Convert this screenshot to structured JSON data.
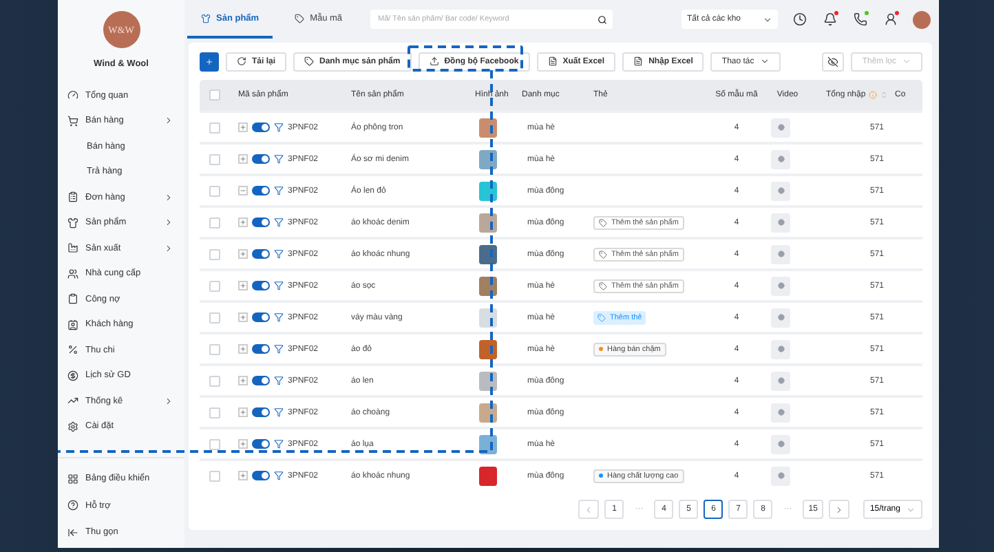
{
  "brand": {
    "logo": "W&W",
    "name": "Wind & Wool"
  },
  "sidebar": {
    "items": [
      {
        "label": "Tổng quan",
        "expandable": false
      },
      {
        "label": "Bán hàng",
        "expandable": true,
        "children": [
          {
            "label": "Bán hàng"
          },
          {
            "label": "Trả hàng"
          }
        ]
      },
      {
        "label": "Đơn hàng",
        "expandable": true
      },
      {
        "label": "Sản phẩm",
        "expandable": true
      },
      {
        "label": "Sản xuất",
        "expandable": true
      },
      {
        "label": "Nhà cung cấp",
        "expandable": false
      },
      {
        "label": "Công nợ",
        "expandable": false
      },
      {
        "label": "Khách hàng",
        "expandable": false
      },
      {
        "label": "Thu chi",
        "expandable": false
      },
      {
        "label": "Lịch sử GD",
        "expandable": false
      },
      {
        "label": "Thống kê",
        "expandable": true
      },
      {
        "label": "Cài đặt",
        "expandable": false
      }
    ],
    "bottom": [
      {
        "label": "Bảng điều khiển"
      },
      {
        "label": "Hỗ trợ"
      },
      {
        "label": "Thu gọn"
      }
    ]
  },
  "tabs": [
    {
      "label": "Sản phẩm",
      "selected": true
    },
    {
      "label": "Mẫu mã",
      "selected": false
    }
  ],
  "search": {
    "placeholder": "Mã/ Tên sản phẩm/ Bar code/ Keyword"
  },
  "warehouse_select": {
    "value": "Tất cả các kho"
  },
  "header_actions": [
    {
      "dot": false
    },
    {
      "dot": true,
      "color": "#f5222d"
    },
    {
      "dot": true,
      "color": "#52c41a"
    },
    {
      "dot": true,
      "color": "#f5222d"
    }
  ],
  "toolbar": {
    "buttons": [
      {
        "kind": "add"
      },
      {
        "kind": "reload",
        "label": "Tải lại"
      },
      {
        "kind": "tag",
        "label": "Danh mục sản phẩm"
      },
      {
        "kind": "upload",
        "label": "Đồng bộ Facebook"
      },
      {
        "kind": "file",
        "label": "Xuất Excel"
      },
      {
        "kind": "file",
        "label": "Nhập Excel"
      },
      {
        "kind": "dropdown",
        "label": "Thao tác"
      }
    ],
    "right": [
      {
        "kind": "eye"
      },
      {
        "kind": "dropdown",
        "label": "Thêm lọc",
        "disabled": true
      }
    ]
  },
  "table": {
    "select_all_checked": false,
    "columns": [
      "Mã sản phẩm",
      "Tên sản phẩm",
      "Hình ảnh",
      "Danh mục",
      "Thẻ",
      "Số mẫu mã",
      "Video",
      "Tổng nhập",
      "Co"
    ],
    "rows": [
      {
        "checked": false,
        "expanded": false,
        "on": true,
        "code": "3PNF02",
        "name": "Áo phông tron",
        "category": "mùa hè",
        "count": "4",
        "total": "571"
      },
      {
        "checked": false,
        "expanded": false,
        "on": true,
        "code": "3PNF02",
        "name": "Áo sơ mi denim",
        "category": "mùa hè",
        "count": "4",
        "total": "571"
      },
      {
        "checked": false,
        "expanded": true,
        "on": true,
        "code": "3PNF02",
        "name": "Áo len đỏ",
        "category": "mùa đông",
        "count": "4",
        "total": "571"
      },
      {
        "checked": false,
        "expanded": false,
        "on": true,
        "code": "3PNF02",
        "name": "áo khoác denim",
        "category": "mùa đông",
        "tag": {
          "kind": "add",
          "label": "Thêm thẻ sản phẩm"
        },
        "count": "4",
        "total": "571"
      },
      {
        "checked": false,
        "expanded": false,
        "on": true,
        "code": "3PNF02",
        "name": "áo khoác nhung",
        "category": "mùa đông",
        "tag": {
          "kind": "add",
          "label": "Thêm thẻ sản phẩm"
        },
        "count": "4",
        "total": "571"
      },
      {
        "checked": false,
        "expanded": false,
        "on": true,
        "code": "3PNF02",
        "name": "áo sọc",
        "category": "mùa hè",
        "tag": {
          "kind": "add",
          "label": "Thêm thẻ sản phẩm"
        },
        "count": "4",
        "total": "571"
      },
      {
        "checked": false,
        "expanded": false,
        "on": true,
        "code": "3PNF02",
        "name": "váy màu vàng",
        "category": "mùa hè",
        "tag": {
          "kind": "add-active",
          "label": "Thêm thẻ"
        },
        "count": "4",
        "total": "571"
      },
      {
        "checked": false,
        "expanded": false,
        "on": true,
        "code": "3PNF02",
        "name": "áo đỏ",
        "category": "mùa hè",
        "tag": {
          "kind": "label",
          "label": "Hàng bán chậm",
          "color": "#fa8c16"
        },
        "count": "4",
        "total": "571"
      },
      {
        "checked": false,
        "expanded": false,
        "on": true,
        "code": "3PNF02",
        "name": "áo len",
        "category": "mùa đông",
        "count": "4",
        "total": "571"
      },
      {
        "checked": false,
        "expanded": false,
        "on": true,
        "code": "3PNF02",
        "name": "áo choàng",
        "category": "mùa đông",
        "count": "4",
        "total": "571"
      },
      {
        "checked": false,
        "expanded": false,
        "on": true,
        "code": "3PNF02",
        "name": "áo lụa",
        "category": "mùa hè",
        "count": "4",
        "total": "571"
      },
      {
        "checked": false,
        "expanded": false,
        "on": true,
        "code": "3PNF02",
        "name": "áo khoác nhung",
        "category": "mùa đông",
        "tag": {
          "kind": "label",
          "label": "Hàng chất lượng cao",
          "color": "#1890ff"
        },
        "count": "4",
        "total": "571"
      }
    ]
  },
  "pagination": {
    "pages": [
      {
        "label": "1",
        "selected": false
      },
      {
        "label": "···",
        "kind": "ellipsis"
      },
      {
        "label": "4",
        "selected": false
      },
      {
        "label": "5",
        "selected": false
      },
      {
        "label": "6",
        "selected": true
      },
      {
        "label": "7",
        "selected": false
      },
      {
        "label": "8",
        "selected": false
      },
      {
        "label": "···",
        "kind": "ellipsis"
      },
      {
        "label": "15",
        "selected": false
      }
    ],
    "page_size": "15/trang"
  }
}
